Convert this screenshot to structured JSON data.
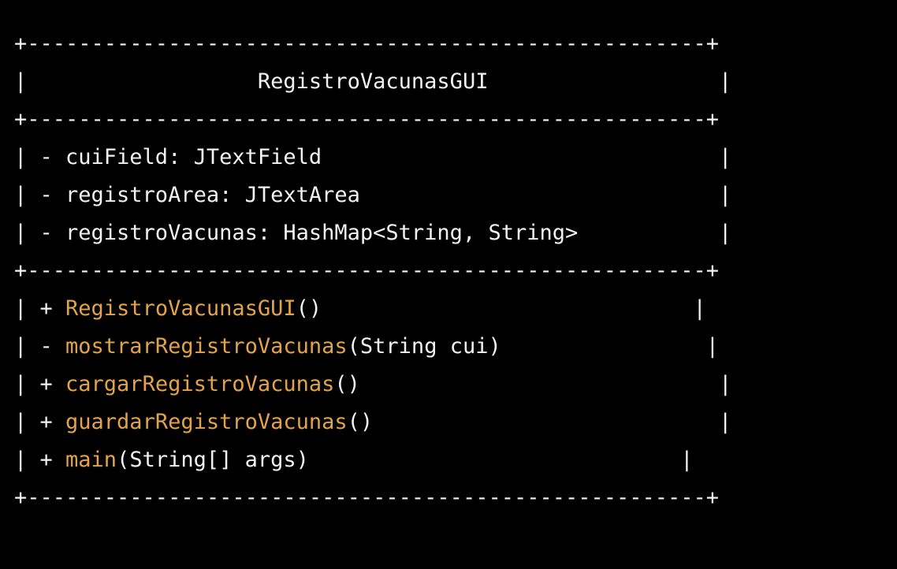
{
  "colors": {
    "background": "#000000",
    "text": "#f2f2f2",
    "method_name": "#e3a34a"
  },
  "diagram": {
    "border_line": "+-----------------------------------------------------+",
    "title_line": "|                  RegistroVacunasGUI                  |",
    "attributes": [
      "| - cuiField: JTextField                               |",
      "| - registroArea: JTextArea                            |",
      "| - registroVacunas: HashMap<String, String>           |"
    ],
    "methods": [
      {
        "prefix": "| + ",
        "name": "RegistroVacunasGUI",
        "suffix": "()                             |"
      },
      {
        "prefix": "| - ",
        "name": "mostrarRegistroVacunas",
        "suffix": "(String cui)                |"
      },
      {
        "prefix": "| + ",
        "name": "cargarRegistroVacunas",
        "suffix": "()                            |"
      },
      {
        "prefix": "| + ",
        "name": "guardarRegistroVacunas",
        "suffix": "()                           |"
      },
      {
        "prefix": "| + ",
        "name": "main",
        "suffix": "(String[] args)                             |"
      }
    ]
  }
}
